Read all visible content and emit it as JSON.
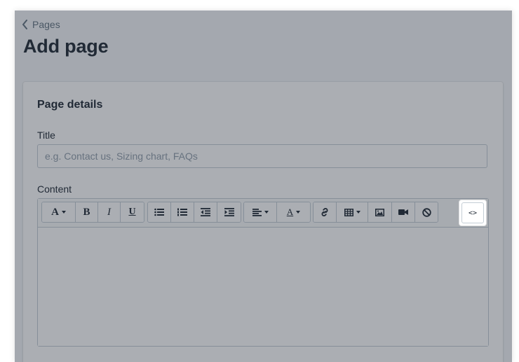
{
  "breadcrumb": {
    "label": "Pages",
    "icon": "chevron-left-icon"
  },
  "page_title": "Add page",
  "card": {
    "title": "Page details",
    "title_field": {
      "label": "Title",
      "placeholder": "e.g. Contact us, Sizing chart, FAQs",
      "value": ""
    },
    "content_field": {
      "label": "Content"
    }
  },
  "toolbar": {
    "format_text": "A",
    "bold": "B",
    "italic": "I",
    "underline": "U",
    "text_color": "A",
    "show_html": "<>"
  },
  "colors": {
    "overlay": "#212b36",
    "page_background": "#f4f6f8",
    "border": "#c4cdd5",
    "placeholder": "#919eab",
    "breadcrumb": "#637381"
  }
}
